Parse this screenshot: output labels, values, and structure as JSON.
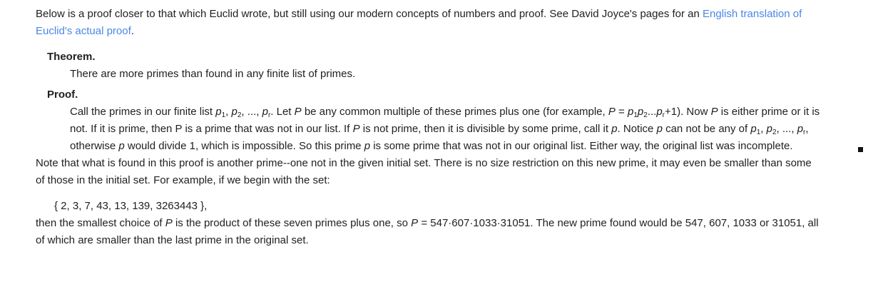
{
  "intro": {
    "text": "Below is a proof closer to that which Euclid wrote, but still using our modern concepts of numbers and proof.  See David Joyce's pages for an ",
    "link_text": "English translation of Euclid's actual proof",
    "end": "."
  },
  "theorem": {
    "label": "Theorem.",
    "text": "There are more primes than found in any finite list of primes."
  },
  "proof": {
    "label": "Proof.",
    "s1": "Call the primes in our finite list ",
    "list": {
      "p": "p",
      "sub1": "1",
      "sep1": ", ",
      "sub2": "2",
      "sep2": ", ..., ",
      "subr": "r"
    },
    "s2": ".  Let ",
    "P": "P",
    "s3": " be any common multiple of these primes plus one (for example, ",
    "eq": " = ",
    "s4": "...",
    "s5": "+1).  Now ",
    "s6": " is either prime or it is not.  If it is prime, then P is a prime that was not in our list.  If ",
    "s7": " is not prime, then it is divisible by some prime, call it ",
    "s8": ".  Notice ",
    "s9": " can not be any of ",
    "s10": ", otherwise ",
    "s11": " would divide 1, which is impossible.  So this prime ",
    "s12": " is some prime that was not in our original list.  Either way, the original list was incomplete."
  },
  "note": {
    "text": "Note that what is found in this proof is another prime--one not in the given initial set.  There is no size restriction on this new prime, it may even be smaller than some of those in the initial set.  For example, if we begin with the set:"
  },
  "set": {
    "text": "{ 2, 3, 7, 43, 13, 139, 3263443 },"
  },
  "conclusion": {
    "s1": "then the smallest choice of ",
    "P": "P",
    "s2": " is the product of these seven primes plus one, so ",
    "eq": " = ",
    "product": "547·607·1033·31051",
    "s3": ".  The new prime found would be 547, 607, 1033 or 31051, all of which are smaller than the last prime in the original set."
  },
  "colors": {
    "link": "#4a86e8",
    "text": "#202124"
  }
}
